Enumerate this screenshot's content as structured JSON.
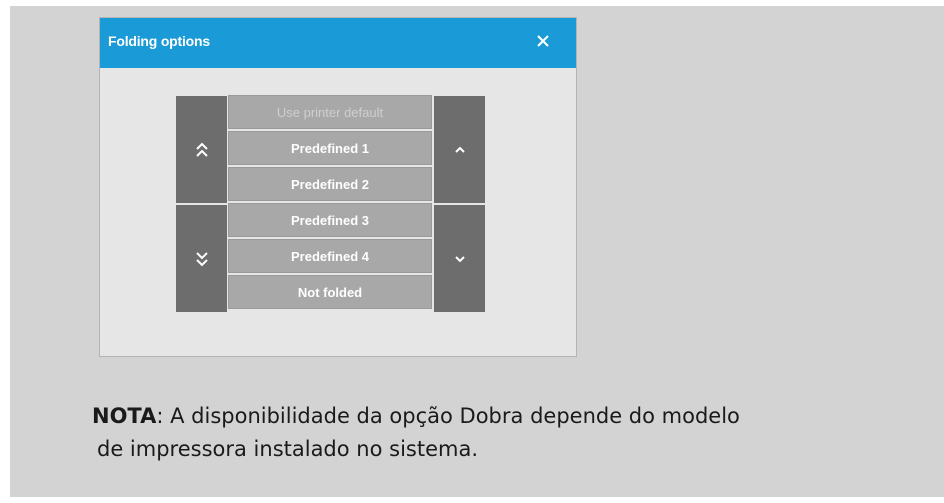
{
  "dialog": {
    "title": "Folding options",
    "close_icon": "close-icon",
    "options": [
      {
        "label": "Use printer default",
        "enabled": false
      },
      {
        "label": "Predefined 1",
        "enabled": true
      },
      {
        "label": "Predefined 2",
        "enabled": true
      },
      {
        "label": "Predefined 3",
        "enabled": true
      },
      {
        "label": "Predefined 4",
        "enabled": true
      },
      {
        "label": "Not folded",
        "enabled": true
      }
    ],
    "nav": {
      "first_icon": "double-chevron-up-icon",
      "last_icon": "double-chevron-down-icon",
      "prev_icon": "chevron-up-icon",
      "next_icon": "chevron-down-icon"
    }
  },
  "note": {
    "label": "NOTA",
    "text_line1": ": A disponibilidade da opção Dobra depende do modelo",
    "text_line2": "de impressora instalado no sistema."
  },
  "colors": {
    "titlebar": "#1a9ad6",
    "background": "#d3d3d3",
    "dialog_body": "#e6e6e6",
    "nav_button": "#6d6d6d",
    "option_item": "#a8a8a8"
  }
}
